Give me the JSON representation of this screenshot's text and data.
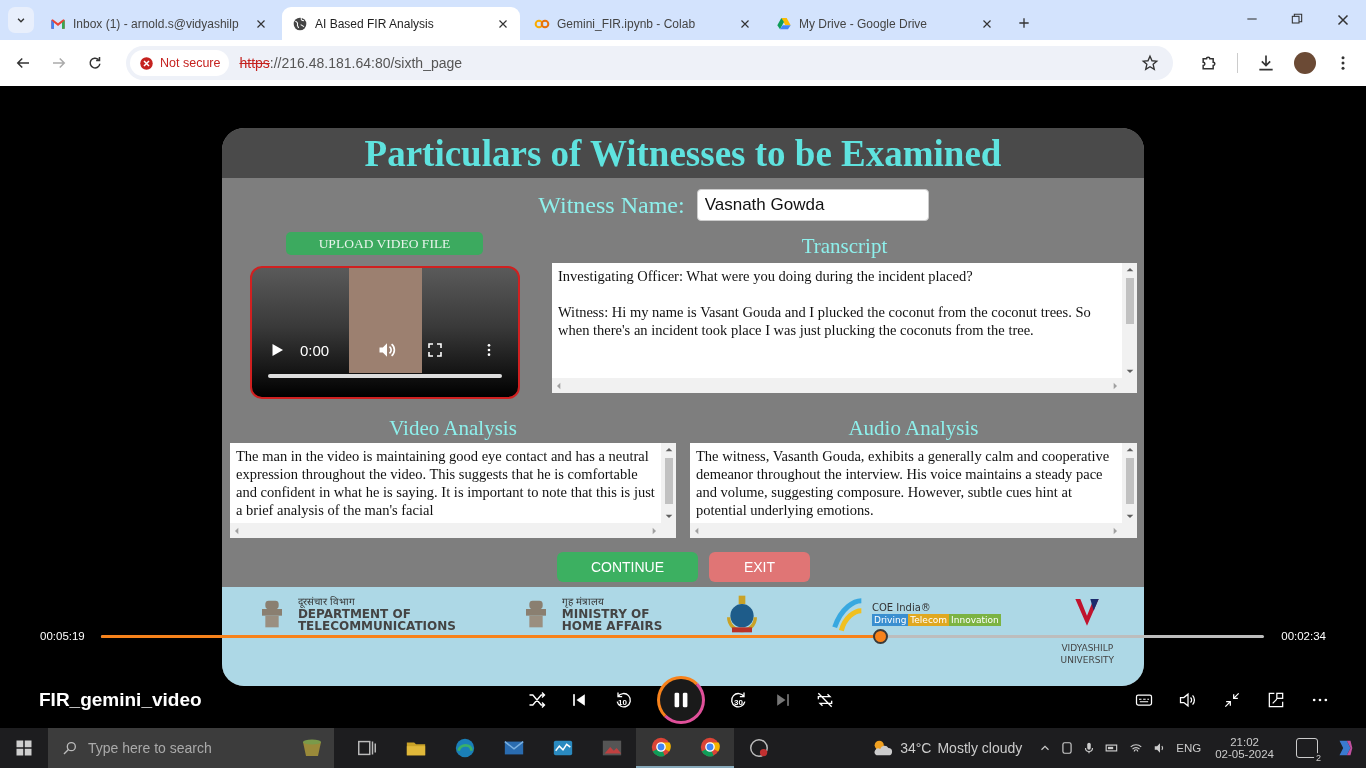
{
  "browser": {
    "tabs": [
      {
        "kind": "mail",
        "title": "Inbox (1) - arnold.s@vidyashilp",
        "selected": false
      },
      {
        "kind": "globe",
        "title": "AI Based FIR Analysis",
        "selected": true
      },
      {
        "kind": "colab",
        "title": "Gemini_FIR.ipynb - Colab",
        "selected": false
      },
      {
        "kind": "drive",
        "title": "My Drive - Google Drive",
        "selected": false
      }
    ],
    "security": "Not secure",
    "url_scheme": "https",
    "url_rest": "://216.48.181.64:80/sixth_page"
  },
  "page": {
    "title": "Particulars of Witnesses to be Examined",
    "witness_label": "Witness Name:",
    "witness_value": "Vasnath Gowda",
    "upload_button": "UPLOAD VIDEO FILE",
    "video": {
      "time": "0:00",
      "level": 0
    },
    "transcript_title": "Transcript",
    "transcript": [
      "Investigating Officer: What were you doing during the incident placed?",
      "Witness: Hi my name is Vasant Gouda and I plucked the coconut from the coconut trees. So when there's an incident took place I was just plucking the coconuts from the tree."
    ],
    "analyses": [
      {
        "title": "Video Analysis",
        "text": "The man in the video is maintaining good eye contact and has a neutral expression throughout the video. This suggests that he is comfortable and confident in what he is saying. It is important to note that this is just a brief analysis of the man's facial"
      },
      {
        "title": "Audio Analysis",
        "text": "The witness, Vasanth Gouda, exhibits a generally calm and cooperative demeanor throughout the interview. His voice maintains a steady pace and volume, suggesting composure. However, subtle cues hint at potential underlying emotions."
      }
    ],
    "buttons": [
      {
        "kind": "continue",
        "label": "CONTINUE"
      },
      {
        "kind": "exit",
        "label": "EXIT"
      }
    ],
    "footer_logos": [
      {
        "kind": "emblem",
        "lines": [
          "दूरसंचार विभाग",
          "DEPARTMENT OF",
          "TELECOMMUNICATIONS"
        ]
      },
      {
        "kind": "emblem",
        "lines": [
          "गृह मंत्रालय",
          "MINISTRY OF",
          "HOME AFFAIRS"
        ]
      },
      {
        "kind": "crest"
      },
      {
        "kind": "coe",
        "lines": [
          "COE India®"
        ],
        "tags": [
          {
            "text": "Driving",
            "color": "#3a8fd0"
          },
          {
            "text": "Telecom",
            "color": "#e0a820"
          },
          {
            "text": "Innovation",
            "color": "#7cb342"
          }
        ]
      },
      {
        "kind": "university",
        "lines": [
          "VIDYASHILP",
          "UNIVERSITY"
        ]
      }
    ]
  },
  "player": {
    "elapsed": "00:05:19",
    "remaining": "00:02:34",
    "level": 0.67,
    "title": "FIR_gemini_video",
    "playing": true,
    "skip_back": "10",
    "skip_forward": "30"
  },
  "taskbar": {
    "search_placeholder": "Type here to search",
    "temperature": "34°C",
    "weather": "Mostly cloudy",
    "language": "ENG",
    "time": "21:02",
    "date": "02-05-2024",
    "notification_count": "2"
  }
}
